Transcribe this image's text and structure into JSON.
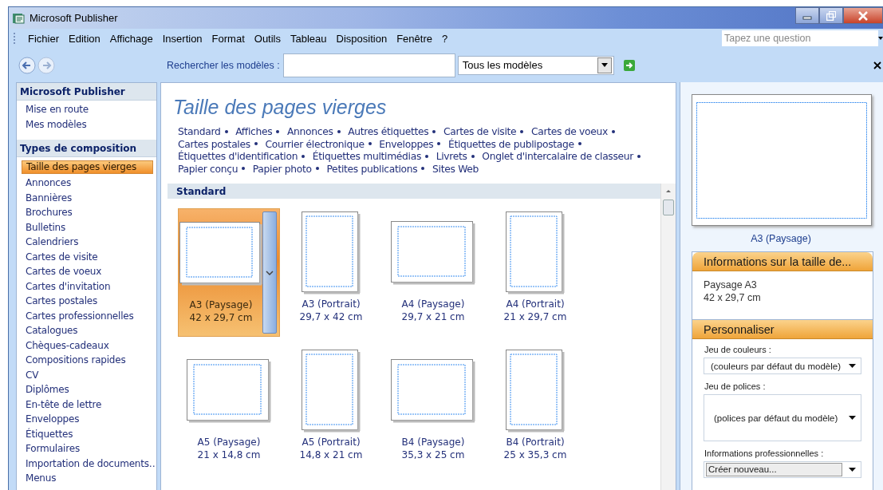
{
  "window": {
    "title": "Microsoft Publisher"
  },
  "menu": [
    "Fichier",
    "Edition",
    "Affichage",
    "Insertion",
    "Format",
    "Outils",
    "Tableau",
    "Disposition",
    "Fenêtre",
    "?"
  ],
  "help_box": {
    "placeholder": "Tapez une question"
  },
  "search": {
    "label": "Rechercher les modèles :",
    "filter": "Tous les modèles"
  },
  "sidebar": [
    {
      "title": "Microsoft Publisher",
      "items": [
        {
          "label": "Mise en route",
          "selected": false
        },
        {
          "label": "Mes modèles",
          "selected": false
        }
      ]
    },
    {
      "title": "Types de composition",
      "items": [
        {
          "label": "Taille des pages vierges",
          "selected": true
        },
        {
          "label": "Annonces",
          "selected": false
        },
        {
          "label": "Bannières",
          "selected": false
        },
        {
          "label": "Brochures",
          "selected": false
        },
        {
          "label": "Bulletins",
          "selected": false
        },
        {
          "label": "Calendriers",
          "selected": false
        },
        {
          "label": "Cartes de visite",
          "selected": false
        },
        {
          "label": "Cartes de voeux",
          "selected": false
        },
        {
          "label": "Cartes d'invitation",
          "selected": false
        },
        {
          "label": "Cartes postales",
          "selected": false
        },
        {
          "label": "Cartes professionnelles",
          "selected": false
        },
        {
          "label": "Catalogues",
          "selected": false
        },
        {
          "label": "Chèques-cadeaux",
          "selected": false
        },
        {
          "label": "Compositions rapides",
          "selected": false
        },
        {
          "label": "CV",
          "selected": false
        },
        {
          "label": "Diplômes",
          "selected": false
        },
        {
          "label": "En-tête de lettre",
          "selected": false
        },
        {
          "label": "Enveloppes",
          "selected": false
        },
        {
          "label": "Étiquettes",
          "selected": false
        },
        {
          "label": "Formulaires",
          "selected": false
        },
        {
          "label": "Importation de documents…",
          "selected": false
        },
        {
          "label": "Menus",
          "selected": false
        }
      ]
    }
  ],
  "content": {
    "title": "Taille des pages vierges",
    "categories": [
      "Standard",
      "Affiches",
      "Annonces",
      "Autres étiquettes",
      "Cartes de visite",
      "Cartes de voeux",
      "Cartes postales",
      "Courrier électronique",
      "Enveloppes",
      "Étiquettes de publipostage",
      "Étiquettes d'identification",
      "Étiquettes multimédias",
      "Livrets",
      "Onglet d'intercalaire de classeur",
      "Papier conçu",
      "Papier photo",
      "Petites publications",
      "Sites Web"
    ],
    "group": "Standard",
    "templates": [
      {
        "name": "A3 (Paysage)",
        "size": "42 x 29,7 cm",
        "kind": "landscape",
        "selected": true
      },
      {
        "name": "A3 (Portrait)",
        "size": "29,7 x 42 cm",
        "kind": "portrait",
        "selected": false
      },
      {
        "name": "A4 (Paysage)",
        "size": "29,7 x 21 cm",
        "kind": "landscape",
        "selected": false
      },
      {
        "name": "A4 (Portrait)",
        "size": "21 x 29,7 cm",
        "kind": "portrait",
        "selected": false
      },
      {
        "name": "A5 (Paysage)",
        "size": "21 x 14,8 cm",
        "kind": "landscape",
        "selected": false
      },
      {
        "name": "A5 (Portrait)",
        "size": "14,8 x 21 cm",
        "kind": "portrait",
        "selected": false
      },
      {
        "name": "B4 (Paysage)",
        "size": "35,3 x 25 cm",
        "kind": "landscape",
        "selected": false
      },
      {
        "name": "B4 (Portrait)",
        "size": "25 x 35,3 cm",
        "kind": "portrait",
        "selected": false
      }
    ]
  },
  "preview": {
    "caption": "A3 (Paysage)"
  },
  "info_panel": {
    "title": "Informations sur la taille de...",
    "lines": [
      "Paysage A3",
      "42 x 29,7 cm"
    ]
  },
  "customize": {
    "title": "Personnaliser",
    "fields": [
      {
        "label": "Jeu de couleurs :",
        "value": "(couleurs par défaut du modèle)",
        "kind": "combo"
      },
      {
        "label": "Jeu de polices :",
        "value": "(polices par défaut du modèle)",
        "kind": "tall"
      },
      {
        "label": "Informations professionnelles :",
        "value": "Créer nouveau...",
        "kind": "boxed"
      }
    ]
  }
}
